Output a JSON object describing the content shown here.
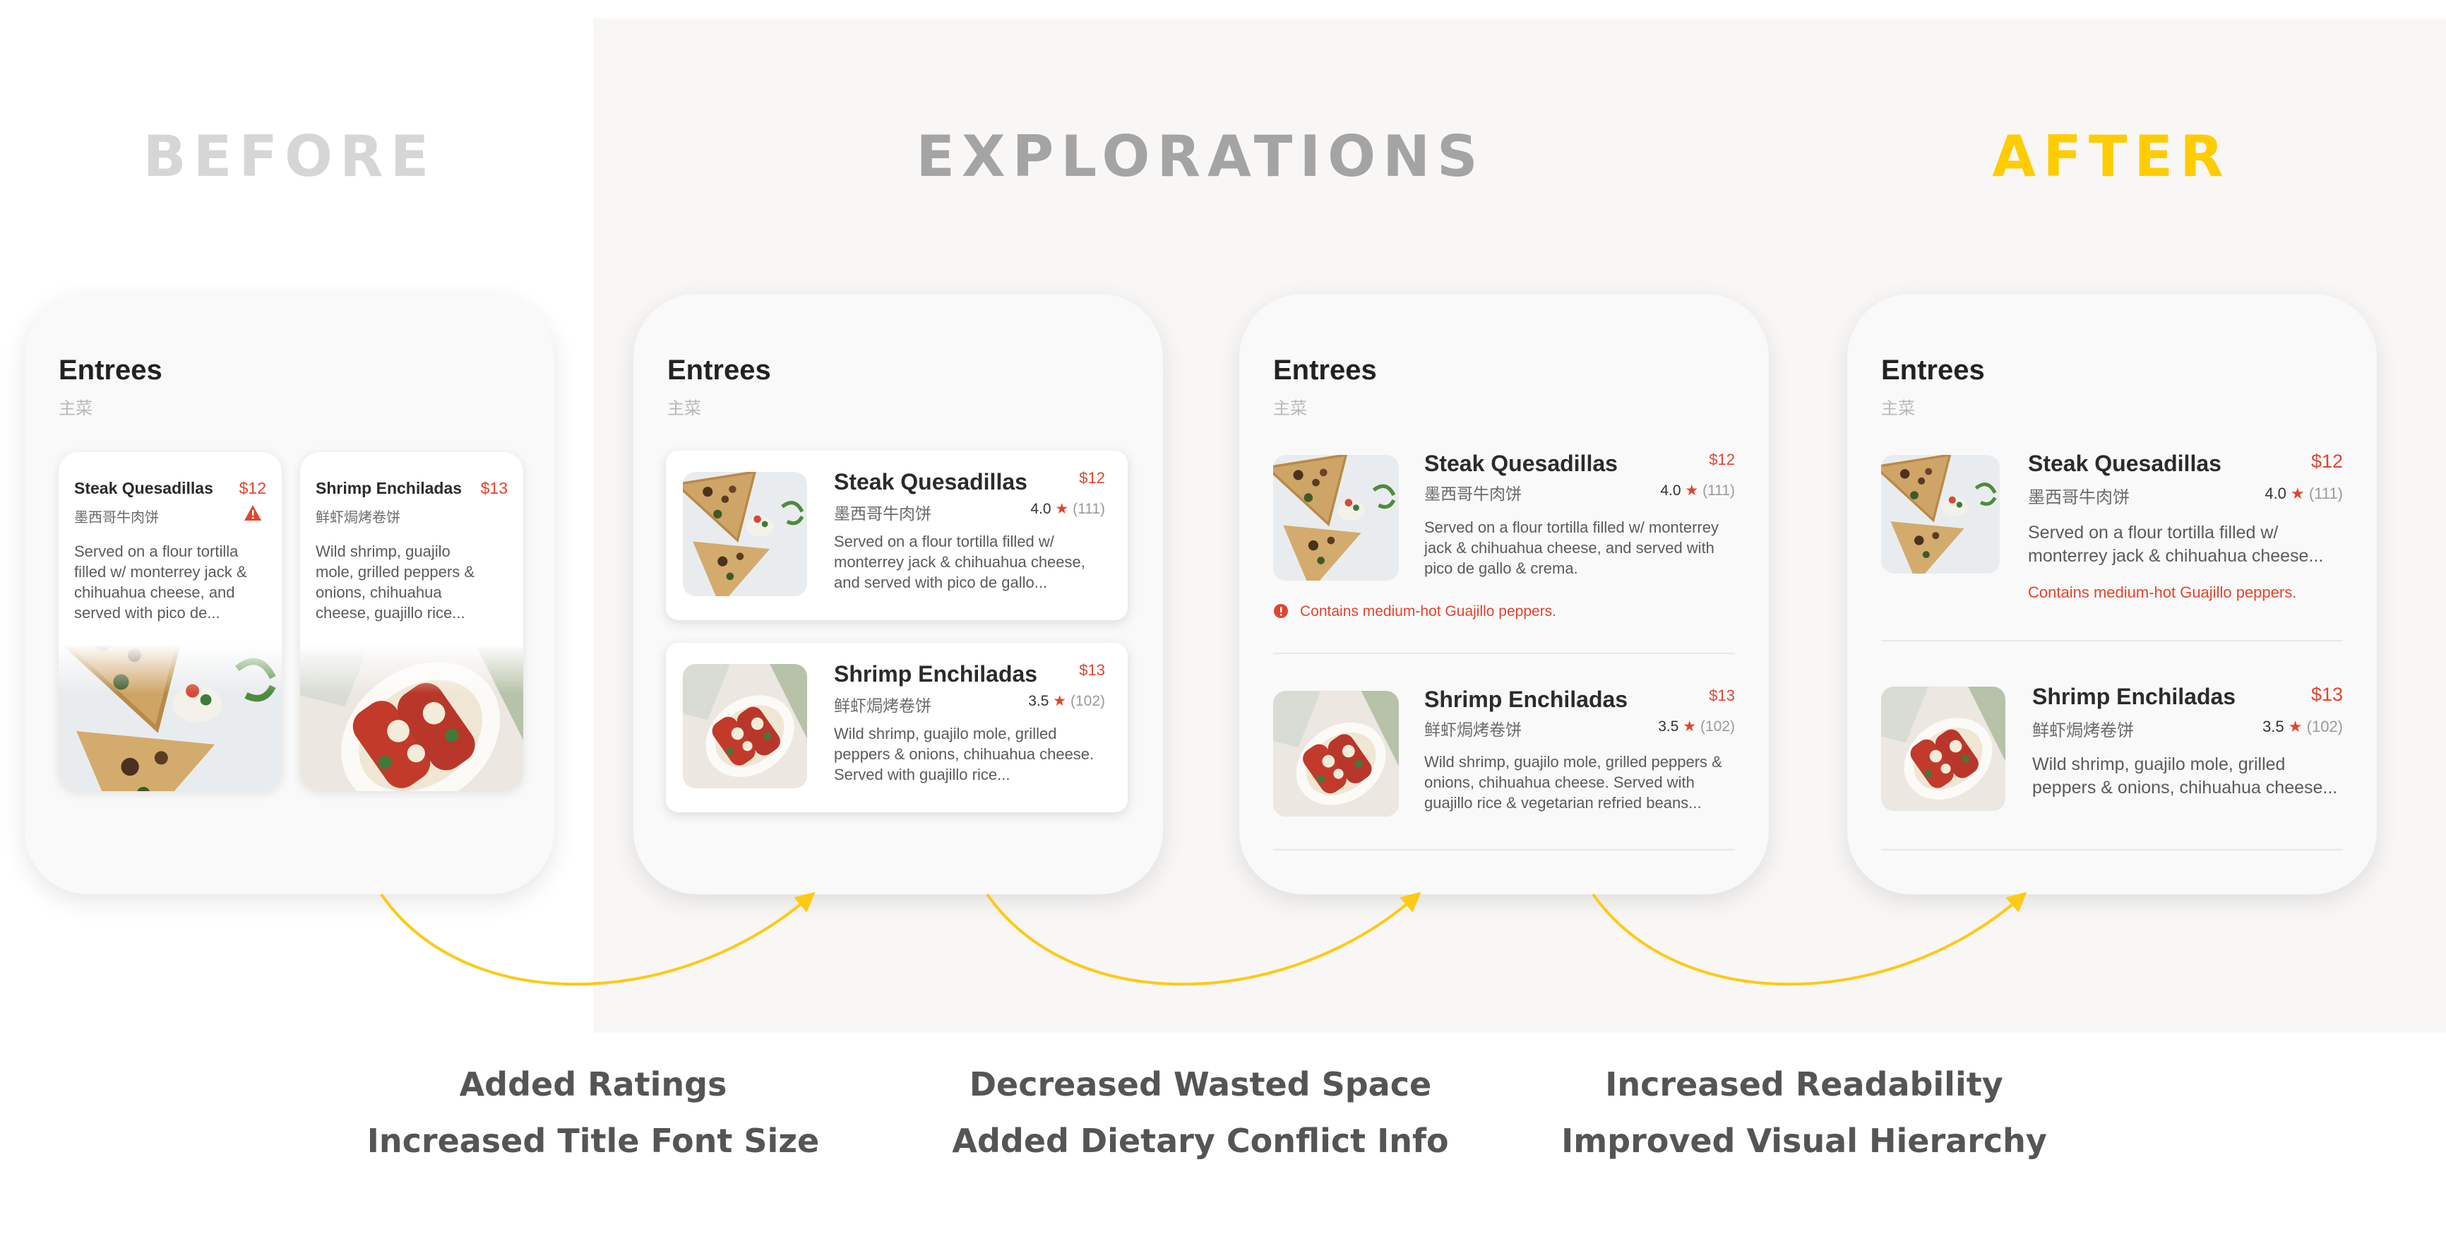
{
  "sections": {
    "before": "BEFORE",
    "explorations": "EXPLORATIONS",
    "after": "AFTER"
  },
  "colors": {
    "before_title": "#d6d6d6",
    "explorations_title": "#a4a4a4",
    "after_title": "#ffcc00",
    "price_red": "#e0452e",
    "arrow_yellow": "#ffc914",
    "explorations_background": "#f8f7f6"
  },
  "menu": {
    "title": "Entrees",
    "subtitle": "主菜",
    "items": [
      {
        "name": "Steak Quesadillas",
        "name_cn": "墨西哥牛肉饼",
        "price": "$12",
        "rating": "4.0",
        "rating_count": "(111)",
        "desc_before": "Served on a flour tortilla filled w/ monterrey jack & chihuahua cheese, and served with pico de...",
        "desc_exp1": "Served on a flour tortilla filled w/ monterrey jack & chihuahua cheese, and served with pico de gallo...",
        "desc_exp2": "Served on a flour tortilla filled w/ monterrey jack & chihuahua cheese, and served with pico de gallo & crema.",
        "desc_after": "Served on a flour tortilla filled w/ monterrey jack & chihuahua cheese...",
        "warning": "Contains medium-hot Guajillo peppers."
      },
      {
        "name": "Shrimp Enchiladas",
        "name_cn": "鲜虾焗烤卷饼",
        "price": "$13",
        "rating": "3.5",
        "rating_count": "(102)",
        "desc_before": "Wild shrimp, guajilo mole, grilled peppers & onions, chihuahua cheese, guajillo rice...",
        "desc_exp1": "Wild shrimp, guajilo mole, grilled peppers & onions, chihuahua cheese. Served with guajillo rice...",
        "desc_exp2": "Wild shrimp, guajilo mole, grilled peppers & onions, chihuahua cheese. Served with guajillo rice & vegetarian refried beans...",
        "desc_after": "Wild shrimp, guajilo mole, grilled peppers & onions, chihuahua cheese..."
      }
    ]
  },
  "captions": [
    {
      "line1": "Added Ratings",
      "line2": "Increased Title Font Size"
    },
    {
      "line1": "Decreased Wasted Space",
      "line2": "Added Dietary Conflict Info"
    },
    {
      "line1": "Increased Readability",
      "line2": "Improved Visual Hierarchy"
    }
  ]
}
